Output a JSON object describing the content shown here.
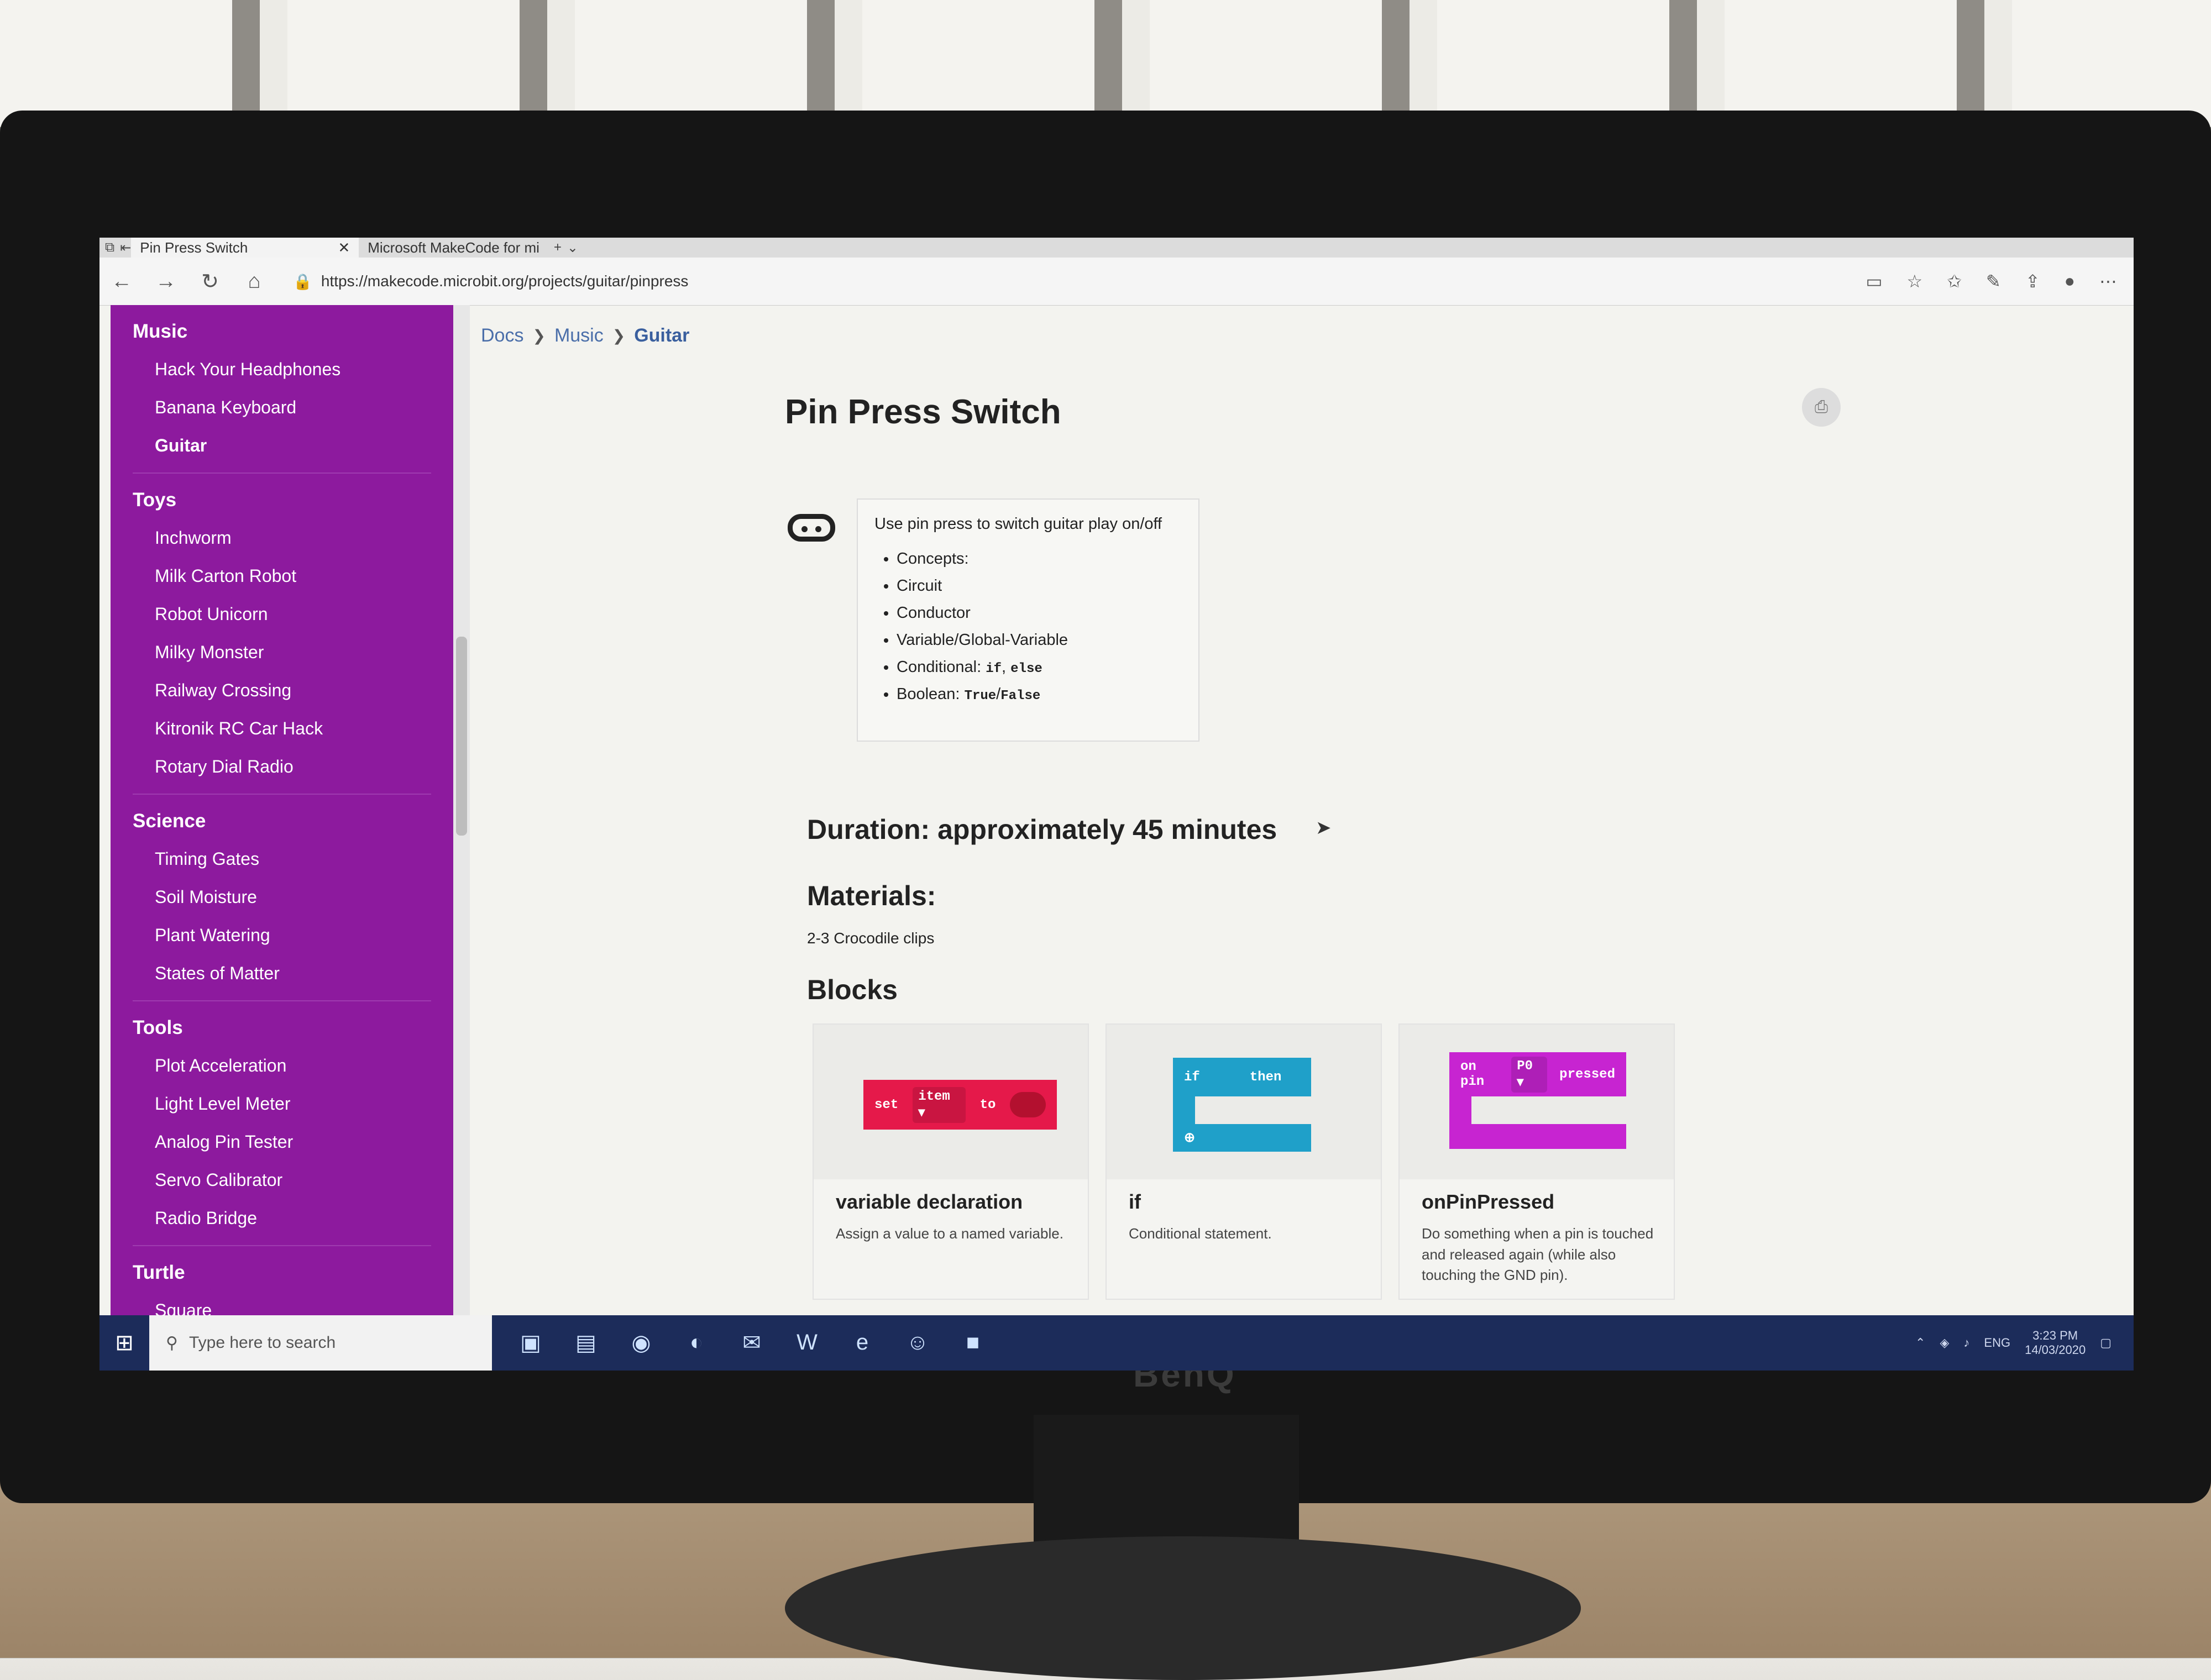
{
  "tabs": [
    {
      "title": "Pin Press Switch",
      "close": "✕"
    },
    {
      "title": "Microsoft MakeCode for mi"
    }
  ],
  "tab_controls": {
    "new_tab": "+",
    "tab_menu": "⌄"
  },
  "address": {
    "url": "https://makecode.microbit.org/projects/guitar/pinpress"
  },
  "sidebar": {
    "sections": [
      {
        "label": "Music",
        "items": [
          "Hack Your Headphones",
          "Banana Keyboard",
          "Guitar"
        ]
      },
      {
        "label": "Toys",
        "items": [
          "Inchworm",
          "Milk Carton Robot",
          "Robot Unicorn",
          "Milky Monster",
          "Railway Crossing",
          "Kitronik RC Car Hack",
          "Rotary Dial Radio"
        ]
      },
      {
        "label": "Science",
        "items": [
          "Timing Gates",
          "Soil Moisture",
          "Plant Watering",
          "States of Matter"
        ]
      },
      {
        "label": "Tools",
        "items": [
          "Plot Acceleration",
          "Light Level Meter",
          "Analog Pin Tester",
          "Servo Calibrator",
          "Radio Bridge"
        ]
      },
      {
        "label": "Turtle",
        "items": [
          "Square"
        ]
      }
    ],
    "current": "Guitar"
  },
  "breadcrumb": [
    "Docs",
    "Music",
    "Guitar"
  ],
  "page": {
    "title": "Pin Press Switch",
    "summary": "Use pin press to switch guitar play on/off",
    "concepts": {
      "heading": "Concepts:",
      "items": [
        "Circuit",
        "Conductor",
        "Variable/Global-Variable"
      ],
      "conditional_label": "Conditional:",
      "conditional_if": "if",
      "conditional_comma": ",",
      "conditional_else": "else",
      "boolean_label": "Boolean:",
      "boolean_true": "True",
      "boolean_slash": "/",
      "boolean_false": "False"
    },
    "duration": "Duration: approximately 45 minutes",
    "materials_heading": "Materials:",
    "materials": "2-3 Crocodile clips",
    "blocks_heading": "Blocks",
    "blocks": [
      {
        "title": "variable declaration",
        "desc": "Assign a value to a named variable.",
        "words": [
          "set",
          "item ▾",
          "to"
        ],
        "color": "#e5194a"
      },
      {
        "title": "if",
        "desc": "Conditional statement.",
        "words": [
          "if",
          "then"
        ],
        "color": "#1fa0c9"
      },
      {
        "title": "onPinPressed",
        "desc": "Do something when a pin is touched and released again (while also touching the GND pin).",
        "words": [
          "on pin",
          "P0 ▾",
          "pressed"
        ],
        "color": "#c724d1"
      }
    ]
  },
  "taskbar": {
    "search_placeholder": "Type here to search",
    "lang": "ENG",
    "time": "3:23 PM",
    "date": "14/03/2020"
  },
  "monitor_brand": "BenQ",
  "colors": {
    "sidebar": "#8d1a9e",
    "accent_link": "#4a6ea9",
    "taskbar": "#1c2c5a"
  }
}
